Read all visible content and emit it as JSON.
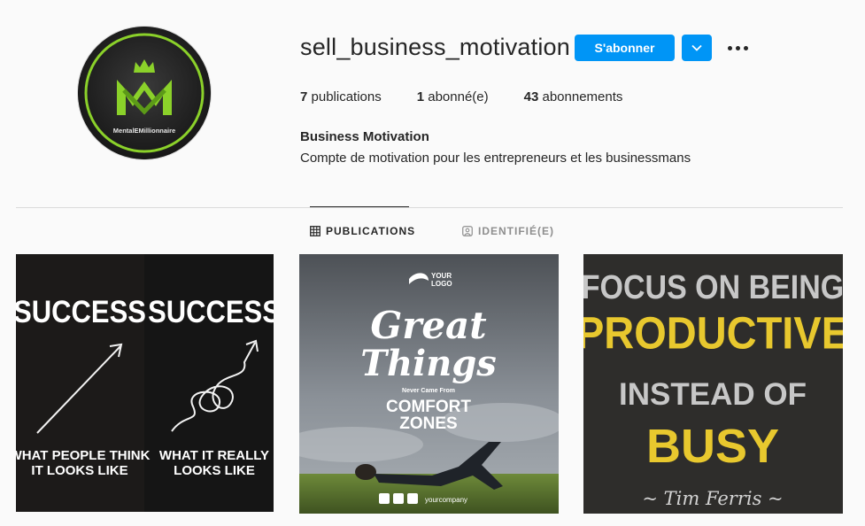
{
  "profile": {
    "username": "sell_business_motivation",
    "follow_label": "S'abonner",
    "avatar_logo_text": "MentalEMillionnaire",
    "stats": {
      "posts_count": "7",
      "posts_label": "publications",
      "followers_count": "1",
      "followers_label": "abonné(e)",
      "following_count": "43",
      "following_label": "abonnements"
    },
    "full_name": "Business Motivation",
    "bio": "Compte de motivation pour les entrepreneurs et les businessmans"
  },
  "tabs": {
    "publications": "PUBLICATIONS",
    "tagged": "IDENTIFIÉ(E)"
  },
  "posts": [
    {
      "left_title": "SUCCESS",
      "right_title": "SUCCESS",
      "left_caption_1": "WHAT PEOPLE THINK",
      "left_caption_2": "IT LOOKS LIKE",
      "right_caption_1": "WHAT IT REALLY",
      "right_caption_2": "LOOKS LIKE"
    },
    {
      "logo_line_1": "YOUR",
      "logo_line_2": "LOGO",
      "script_1": "Great",
      "script_2": "Things",
      "small": "Never Came From",
      "big_1": "COMFORT",
      "big_2": "ZONES",
      "company": "yourcompany"
    },
    {
      "line_1": "FOCUS ON BEING",
      "line_2": "PRODUCTIVE",
      "line_3": "INSTEAD OF",
      "line_4": "BUSY",
      "author": "~ Tim Ferris ~"
    }
  ],
  "colors": {
    "accent_blue": "#0095f6",
    "logo_green": "#8bd12a",
    "quote_yellow": "#e8c82e"
  }
}
